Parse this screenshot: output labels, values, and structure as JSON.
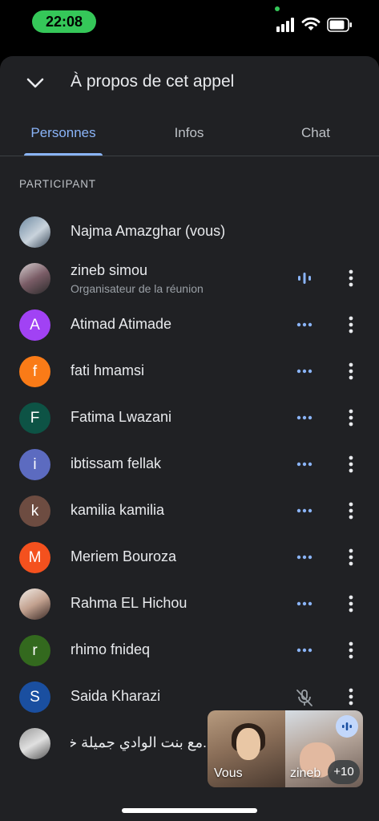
{
  "status_bar": {
    "time": "22:08",
    "icons": [
      "signal-icon",
      "wifi-icon",
      "battery-icon"
    ]
  },
  "header": {
    "title": "À propos de cet appel",
    "collapse_icon": "chevron-down-icon"
  },
  "tabs": [
    {
      "label": "Personnes",
      "active": true
    },
    {
      "label": "Infos",
      "active": false
    },
    {
      "label": "Chat",
      "active": false
    }
  ],
  "section_label": "PARTICIPANT",
  "participants": [
    {
      "name": "Najma Amazghar (vous)",
      "avatar": "photo",
      "status": "none"
    },
    {
      "name": "zineb simou",
      "subtitle": "Organisateur de la réunion",
      "avatar": "photo",
      "status": "speaking"
    },
    {
      "name": "Atimad Atimade",
      "initial": "A",
      "color": "#a142f4",
      "status": "connecting"
    },
    {
      "name": "fati hmamsi",
      "initial": "f",
      "color": "#fa7b17",
      "status": "connecting"
    },
    {
      "name": "Fatima Lwazani",
      "initial": "F",
      "color": "#0d5345",
      "status": "connecting"
    },
    {
      "name": "ibtissam fellak",
      "initial": "i",
      "color": "#5c6bc0",
      "status": "connecting"
    },
    {
      "name": "kamilia kamilia",
      "initial": "k",
      "color": "#6d4c41",
      "status": "connecting"
    },
    {
      "name": "Meriem Bouroza",
      "initial": "M",
      "color": "#f4511e",
      "status": "connecting"
    },
    {
      "name": "Rahma EL Hichou",
      "avatar": "photo",
      "status": "connecting"
    },
    {
      "name": "rhimo fnideq",
      "initial": "r",
      "color": "#33691e",
      "status": "connecting"
    },
    {
      "name": "Saida Kharazi",
      "initial": "S",
      "color": "#1a4fa0",
      "status": "muted"
    },
    {
      "name": "...مع بنت الوادي جميلة خـ",
      "avatar": "photo",
      "status": "none"
    }
  ],
  "pip": {
    "self_label": "Vous",
    "other_label": "zineb",
    "more_count": "+10"
  },
  "colors": {
    "accent": "#8ab4f8",
    "sheet_bg": "#202124",
    "time_pill": "#35c759"
  }
}
